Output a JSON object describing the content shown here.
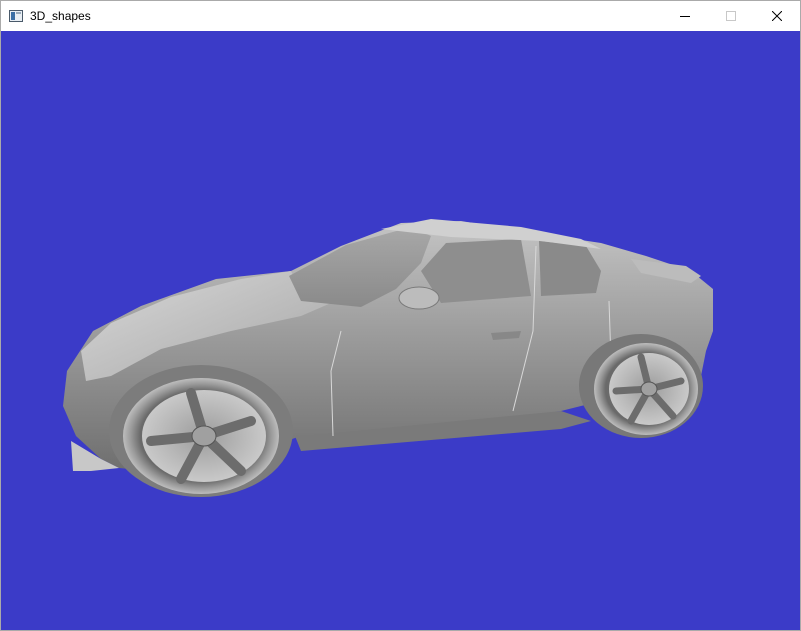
{
  "window": {
    "title": "3D_shapes",
    "controls": {
      "minimize": "minimize-icon",
      "maximize": "maximize-icon",
      "close": "close-icon"
    }
  },
  "viewport": {
    "background_color": "#3B3BC8",
    "model_color": "#9A9A9A",
    "object": "car-model"
  }
}
